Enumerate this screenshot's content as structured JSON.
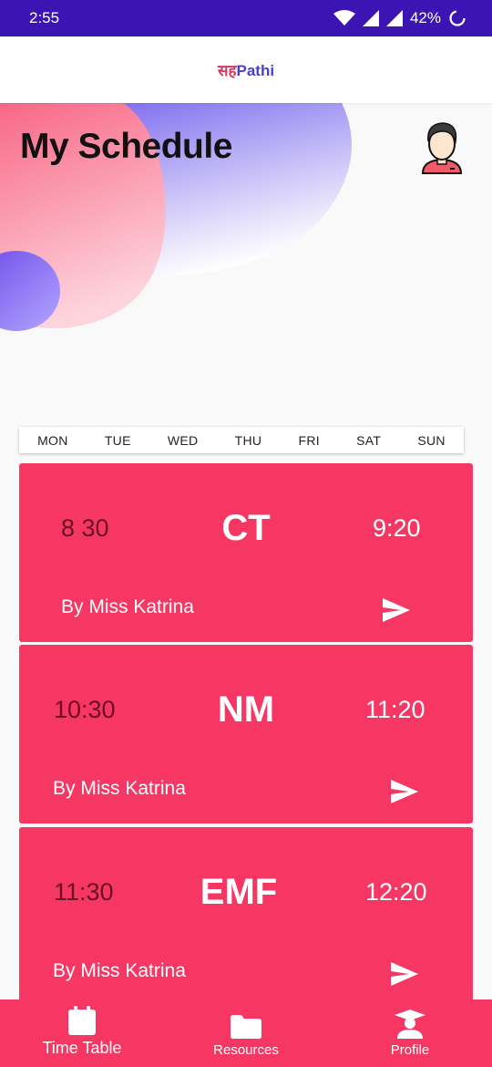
{
  "status_bar": {
    "time": "2:55",
    "battery": "42%"
  },
  "app": {
    "logo_part1": "सह",
    "logo_part2": "Pathi"
  },
  "page": {
    "title": "My Schedule"
  },
  "days": [
    "MON",
    "TUE",
    "WED",
    "THU",
    "FRI",
    "SAT",
    "SUN"
  ],
  "schedule": [
    {
      "start": "8 30",
      "subject": "CT",
      "end": "9:20",
      "teacher": "By Miss Katrina"
    },
    {
      "start": "10:30",
      "subject": "NM",
      "end": "11:20",
      "teacher": "By Miss Katrina"
    },
    {
      "start": "11:30",
      "subject": "EMF",
      "end": "12:20",
      "teacher": "By Miss Katrina"
    }
  ],
  "bottom_nav": [
    {
      "label": "Time Table",
      "icon": "calendar-icon"
    },
    {
      "label": "Resources",
      "icon": "folder-icon"
    },
    {
      "label": "Profile",
      "icon": "graduate-icon"
    }
  ],
  "colors": {
    "status_bar": "#3c14b4",
    "accent": "#f63763",
    "blob_pink": "#f9738f",
    "blob_purple": "#7b68ee"
  }
}
